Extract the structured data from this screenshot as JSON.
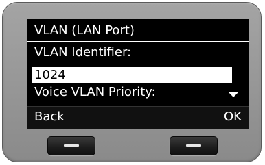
{
  "screen": {
    "title": "VLAN (LAN Port)",
    "vlan_identifier_label": "VLAN Identifier:",
    "vlan_identifier_value": "1024",
    "voice_vlan_priority_label": "Voice VLAN Priority:",
    "scroll_indicator_icon": "triangle-down-icon"
  },
  "softkeys": {
    "left_label": "Back",
    "right_label": "OK"
  },
  "colors": {
    "screen_background": "#000000",
    "screen_text": "#ffffff",
    "highlight_field": "#ffffff",
    "device_body": "#969696"
  }
}
